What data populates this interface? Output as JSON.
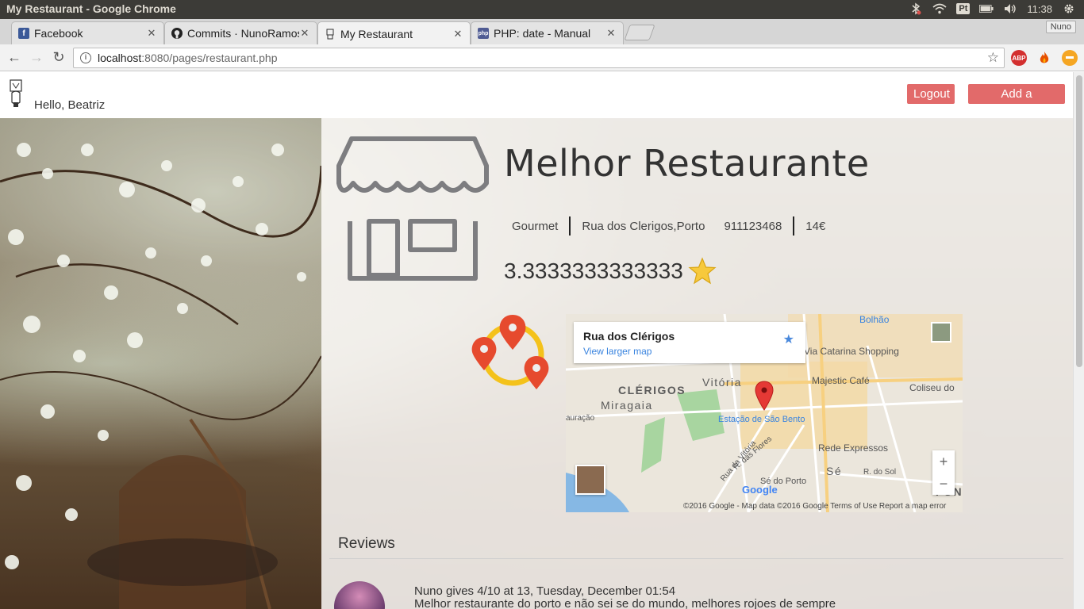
{
  "os": {
    "window_title": "My Restaurant - Google Chrome",
    "lang": "Pt",
    "clock": "11:38"
  },
  "tabs": [
    {
      "label": "Facebook",
      "icon": "facebook-icon"
    },
    {
      "label": "Commits · NunoRamos",
      "icon": "github-icon"
    },
    {
      "label": "My Restaurant",
      "icon": "restaurant-logo-icon",
      "active": true
    },
    {
      "label": "PHP: date - Manual",
      "icon": "php-icon"
    }
  ],
  "profile": "Nuno",
  "toolbar": {
    "url_host": "localhost",
    "url_rest": ":8080/pages/restaurant.php",
    "adblock": "ABP"
  },
  "header": {
    "greeting": "Hello, Beatriz",
    "logout_label": "Logout",
    "add_label": "Add a restaurant"
  },
  "restaurant": {
    "name": "Melhor Restaurante",
    "category": "Gourmet",
    "address": "Rua dos Clerigos,Porto",
    "phone": "911123468",
    "price": "14€",
    "rating": "3.3333333333333"
  },
  "map": {
    "place_title": "Rua dos Clérigos",
    "larger_link": "View larger map",
    "labels": {
      "bolhao": "Bolhão",
      "catarina": "Via Catarina Shopping",
      "majestic": "Majestic Café",
      "coliseu": "Coliseu do",
      "clerigos": "CLÉRIGOS",
      "vitoria": "Vitória",
      "miragaia": "Miragaia",
      "estacao": "Estação de São Bento",
      "rede": "Rede Expressos",
      "auracao": "auração",
      "rua_vitoria": "Rua da Vitória",
      "flores": "R. das Flores",
      "se_porto": "Sé do Porto",
      "se": "Sé",
      "r_sol": "R. do Sol",
      "fon": "FON"
    },
    "footer": "©2016 Google - Map data ©2016 Google    Terms of Use    Report a map error",
    "google": "Google"
  },
  "reviews": {
    "title": "Reviews",
    "items": [
      {
        "header": "Nuno gives 4/10 at 13, Tuesday, December 01:54",
        "text": "Melhor restaurante do porto e não sei se do mundo, melhores rojoes de sempre"
      }
    ]
  },
  "colors": {
    "accent_button": "#e26a6a",
    "link_blue": "#3a84df"
  }
}
